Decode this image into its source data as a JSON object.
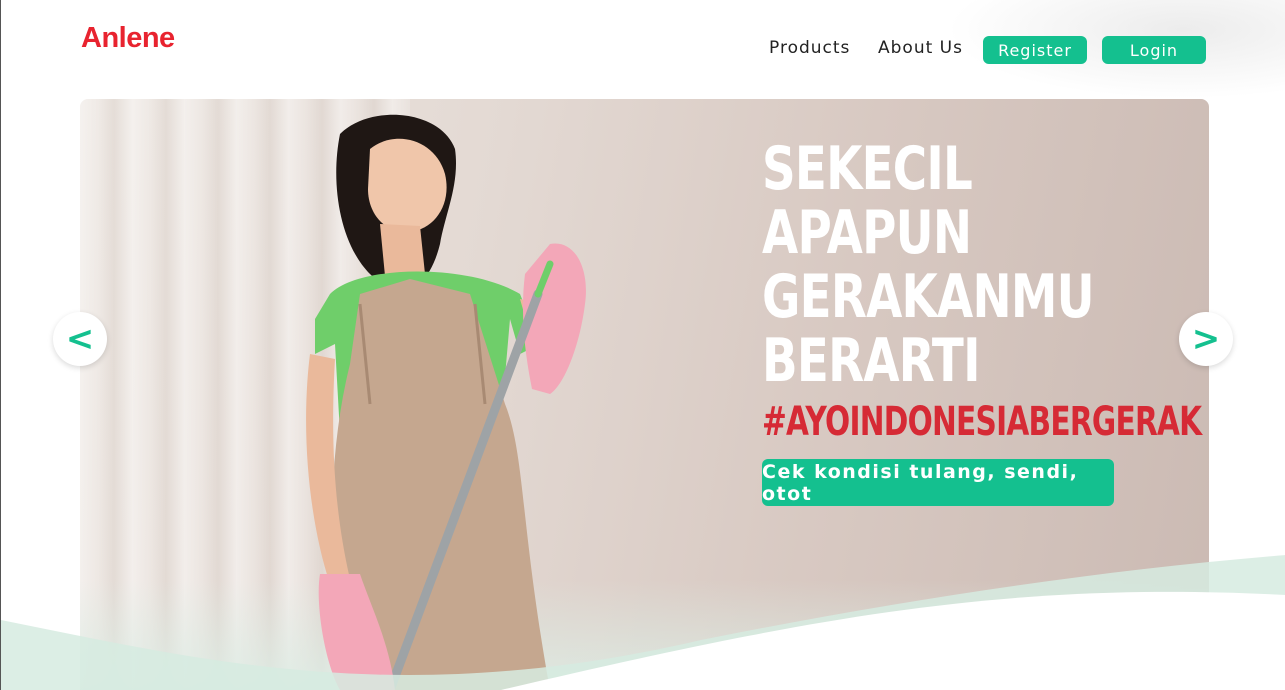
{
  "header": {
    "logo": "Anlene",
    "nav": {
      "products": "Products",
      "about": "About Us",
      "register": "Register",
      "login": "Login"
    }
  },
  "hero": {
    "headline_lines": [
      "SEKECIL",
      "APAPUN",
      "GERAKANMU",
      "BERARTI"
    ],
    "hashtag": "#AYOINDONESIABERGERAK",
    "cta": "Cek kondisi tulang, sendi, otot",
    "prev_arrow": "<",
    "next_arrow": ">"
  },
  "colors": {
    "brand_red": "#e8232f",
    "accent_green": "#14c08f",
    "hashtag_red": "#d62a35"
  },
  "icons": {
    "prev": "chevron-left-icon",
    "next": "chevron-right-icon"
  }
}
